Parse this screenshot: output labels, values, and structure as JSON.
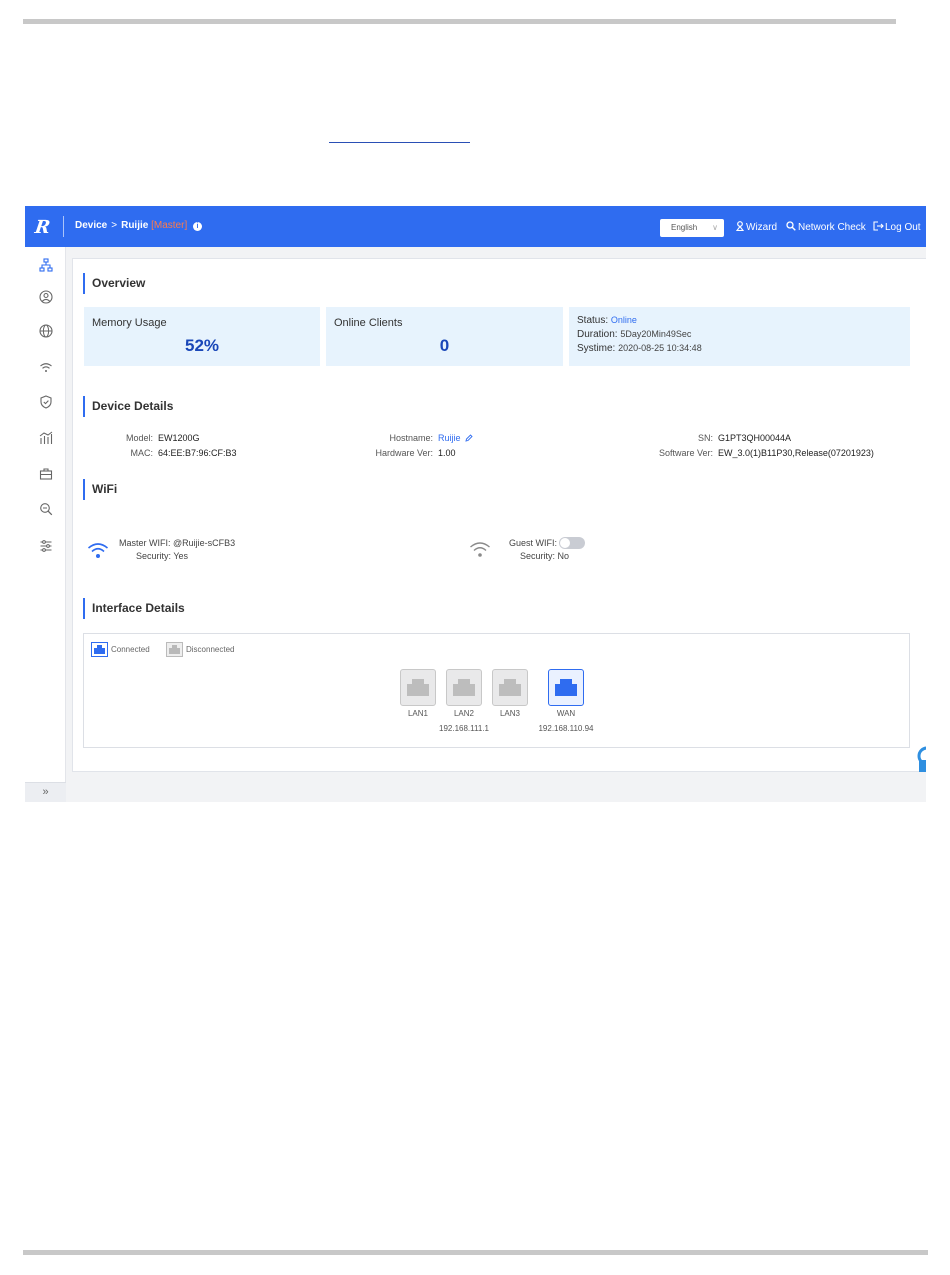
{
  "topbar": {
    "logo": "R",
    "crumb_device": "Device",
    "crumb_sep": ">",
    "crumb_host": "Ruijie",
    "crumb_role": "[Master]",
    "info": "i",
    "language": "English",
    "wizard": "Wizard",
    "network_check": "Network Check",
    "logout": "Log Out"
  },
  "sidebar": {
    "items": [
      "topology-icon",
      "user-icon",
      "globe-icon",
      "wifi-icon",
      "shield-icon",
      "chart-icon",
      "toolbox-icon",
      "diagnose-icon",
      "settings-icon"
    ],
    "collapse": "»"
  },
  "overview": {
    "title": "Overview",
    "memory_label": "Memory Usage",
    "memory_value": "52%",
    "clients_label": "Online Clients",
    "clients_value": "0",
    "status_label": "Status:",
    "status_value": "Online",
    "duration_label": "Duration:",
    "duration_value": "5Day20Min49Sec",
    "systime_label": "Systime:",
    "systime_value": "2020-08-25 10:34:48"
  },
  "device": {
    "title": "Device Details",
    "model_label": "Model:",
    "model_value": "EW1200G",
    "mac_label": "MAC:",
    "mac_value": "64:EE:B7:96:CF:B3",
    "hostname_label": "Hostname:",
    "hostname_value": "Ruijie",
    "hw_label": "Hardware Ver:",
    "hw_value": "1.00",
    "sn_label": "SN:",
    "sn_value": "G1PT3QH00044A",
    "sw_label": "Software Ver:",
    "sw_value": "EW_3.0(1)B11P30,Release(07201923)"
  },
  "wifi": {
    "title": "WiFi",
    "master_label": "Master WIFI:",
    "master_value": "@Ruijie-sCFB3",
    "master_security_label": "Security:",
    "master_security_value": "Yes",
    "guest_label": "Guest WIFI:",
    "guest_enabled": false,
    "guest_security_label": "Security:",
    "guest_security_value": "No"
  },
  "interfaces": {
    "title": "Interface Details",
    "legend_connected": "Connected",
    "legend_disconnected": "Disconnected",
    "ports": [
      {
        "label": "LAN1",
        "connected": false,
        "ip": ""
      },
      {
        "label": "LAN2",
        "connected": false,
        "ip": "192.168.111.1"
      },
      {
        "label": "LAN3",
        "connected": false,
        "ip": ""
      },
      {
        "label": "WAN",
        "connected": true,
        "ip": "192.168.110.94"
      }
    ]
  },
  "colors": {
    "accent": "#2f6cf0",
    "value_blue": "#1a47b8",
    "role_orange": "#ff7b4a",
    "stat_bg": "#e7f3fd"
  }
}
